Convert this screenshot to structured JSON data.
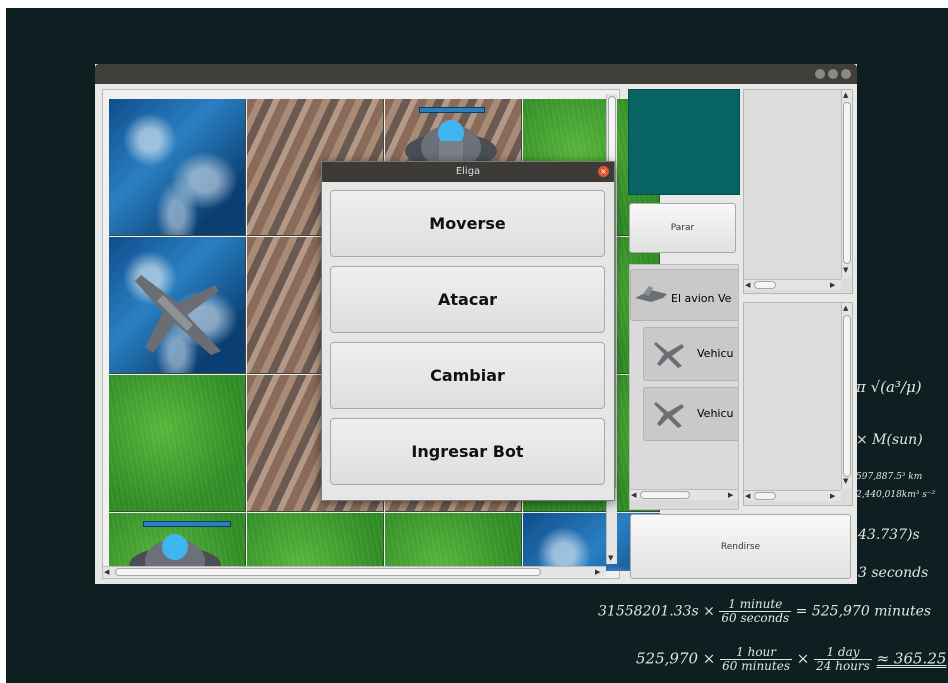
{
  "dialog": {
    "title": "Eliga",
    "options": [
      "Moverse",
      "Atacar",
      "Cambiar",
      "Ingresar Bot"
    ]
  },
  "side": {
    "stop_label": "Parar",
    "surrender_label": "Rendirse",
    "selected_unit": "El avion Ve",
    "units": [
      "Vehicu",
      "Vehicu"
    ]
  },
  "colors": {
    "team": "#086463",
    "close": "#e2582c"
  },
  "chalkboard": {
    "formula_sqrt": "π √(a³/μ)",
    "mass": "× M(sun)",
    "distance": "597,887.5³ km",
    "gm": "2,440,018km³ s⁻²",
    "period": "43.737)s",
    "seconds_tail": "3 seconds",
    "line1_value": "31558201.33s",
    "line1_mult": "×",
    "line1_num": "1 minute",
    "line1_den": "60 seconds",
    "line1_result": "= 525,970 minutes",
    "line2_value": "525,970 ×",
    "line2_num1": "1 hour",
    "line2_den1": "60 minutes",
    "line2_mult": "×",
    "line2_num2": "1 day",
    "line2_den2": "24 hours",
    "line2_result": "≈ 365.25"
  }
}
